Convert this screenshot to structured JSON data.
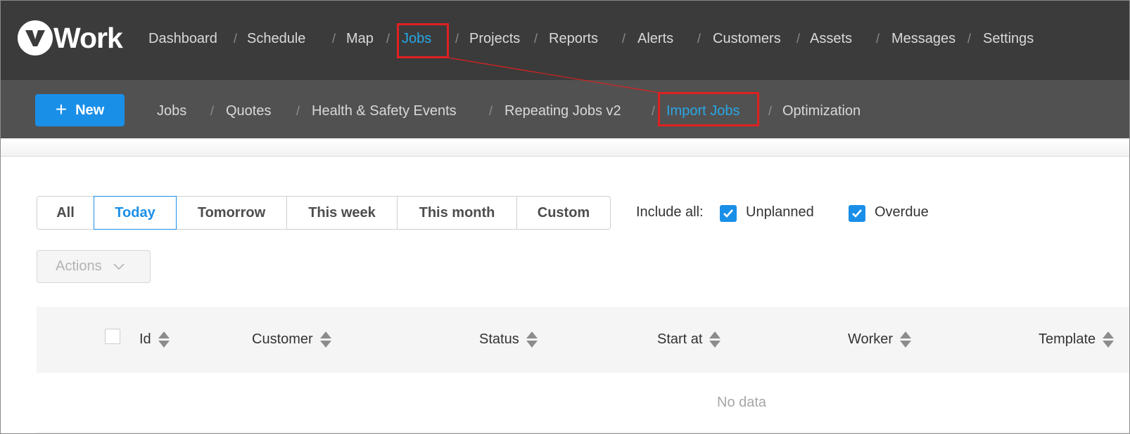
{
  "brand": {
    "logo_word": "Work"
  },
  "topnav": {
    "items": [
      {
        "label": "Dashboard"
      },
      {
        "label": "Schedule"
      },
      {
        "label": "Map"
      },
      {
        "label": "Jobs",
        "active": true
      },
      {
        "label": "Projects"
      },
      {
        "label": "Reports"
      },
      {
        "label": "Alerts"
      },
      {
        "label": "Customers"
      },
      {
        "label": "Assets"
      },
      {
        "label": "Messages"
      },
      {
        "label": "Settings"
      }
    ],
    "separator": "/"
  },
  "subnav": {
    "new_button": "New",
    "items": [
      {
        "label": "Jobs"
      },
      {
        "label": "Quotes"
      },
      {
        "label": "Health & Safety Events"
      },
      {
        "label": "Repeating Jobs v2"
      },
      {
        "label": "Import Jobs",
        "active": true
      },
      {
        "label": "Optimization"
      }
    ]
  },
  "filters": {
    "segments": [
      {
        "label": "All"
      },
      {
        "label": "Today",
        "active": true
      },
      {
        "label": "Tomorrow"
      },
      {
        "label": "This week"
      },
      {
        "label": "This month"
      },
      {
        "label": "Custom"
      }
    ],
    "include_label": "Include all:",
    "checkboxes": [
      {
        "label": "Unplanned",
        "checked": true
      },
      {
        "label": "Overdue",
        "checked": true
      }
    ]
  },
  "actions": {
    "label": "Actions"
  },
  "table": {
    "columns": [
      {
        "label": "Id"
      },
      {
        "label": "Customer"
      },
      {
        "label": "Status"
      },
      {
        "label": "Start at"
      },
      {
        "label": "Worker"
      },
      {
        "label": "Template"
      }
    ],
    "empty_text": "No data"
  },
  "colors": {
    "accent": "#1a8fe8",
    "active_link": "#29a7e6",
    "highlight": "#e02020",
    "topnav_bg": "#3b3b3b",
    "subnav_bg": "#515151"
  },
  "icons": {
    "logo": "v-logo-circle",
    "plus": "plus-icon",
    "checkbox": "check-icon",
    "dropdown": "chevron-down-icon",
    "sort": "sort-icon"
  }
}
